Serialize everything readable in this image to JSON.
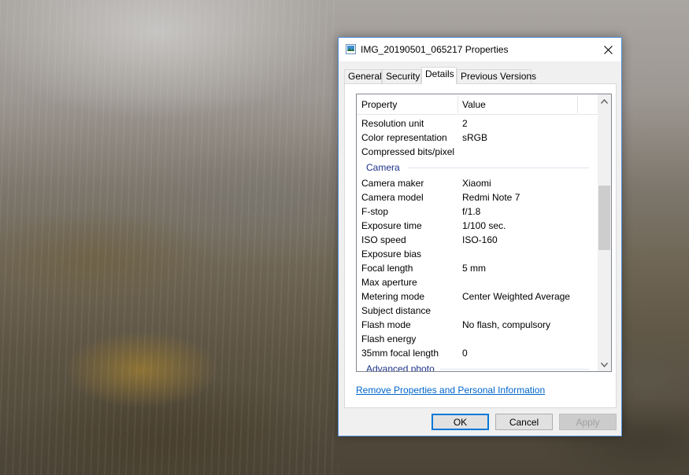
{
  "window": {
    "title": "IMG_20190501_065217 Properties",
    "icon": "image-file-icon"
  },
  "tabs": [
    {
      "label": "General",
      "active": false
    },
    {
      "label": "Security",
      "active": false
    },
    {
      "label": "Details",
      "active": true
    },
    {
      "label": "Previous Versions",
      "active": false
    }
  ],
  "list": {
    "columns": {
      "property": "Property",
      "value": "Value"
    },
    "rows_top": [
      {
        "name": "Resolution unit",
        "value": "2"
      },
      {
        "name": "Color representation",
        "value": "sRGB"
      },
      {
        "name": "Compressed bits/pixel",
        "value": ""
      }
    ],
    "group_camera": "Camera",
    "rows_camera": [
      {
        "name": "Camera maker",
        "value": "Xiaomi"
      },
      {
        "name": "Camera model",
        "value": "Redmi Note 7"
      },
      {
        "name": "F-stop",
        "value": "f/1.8"
      },
      {
        "name": "Exposure time",
        "value": "1/100 sec."
      },
      {
        "name": "ISO speed",
        "value": "ISO-160"
      },
      {
        "name": "Exposure bias",
        "value": ""
      },
      {
        "name": "Focal length",
        "value": "5 mm"
      },
      {
        "name": "Max aperture",
        "value": ""
      },
      {
        "name": "Metering mode",
        "value": "Center Weighted Average"
      },
      {
        "name": "Subject distance",
        "value": ""
      },
      {
        "name": "Flash mode",
        "value": "No flash, compulsory"
      },
      {
        "name": "Flash energy",
        "value": ""
      },
      {
        "name": "35mm focal length",
        "value": "0"
      }
    ],
    "group_advanced": "Advanced photo"
  },
  "remove_link": "Remove Properties and Personal Information",
  "buttons": {
    "ok": "OK",
    "cancel": "Cancel",
    "apply": "Apply"
  },
  "colors": {
    "accent": "#0078d7",
    "link": "#0066cc",
    "group_header": "#1e3287",
    "window_border": "#4f8bd6"
  }
}
